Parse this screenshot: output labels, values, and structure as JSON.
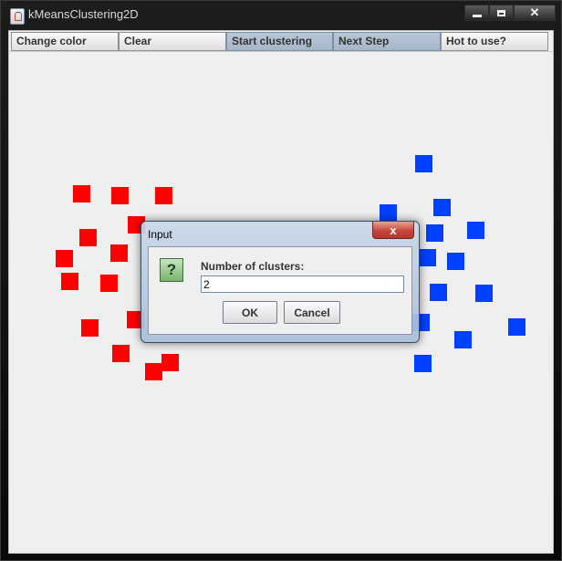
{
  "window": {
    "title": "kMeansClustering2D",
    "app_icon": "java-icon"
  },
  "toolbar": {
    "buttons": [
      {
        "label": "Change color",
        "active": false
      },
      {
        "label": "Clear",
        "active": false
      },
      {
        "label": "Start clustering",
        "active": true
      },
      {
        "label": "Next Step",
        "active": true
      },
      {
        "label": "Hot to use?",
        "active": false
      }
    ]
  },
  "colors": {
    "red_points": "#ff0000",
    "blue_points": "#0040ff",
    "canvas_bg": "#efefef"
  },
  "dialog": {
    "title": "Input",
    "close_glyph": "x",
    "icon": "question-icon",
    "icon_glyph": "?",
    "prompt": "Number of clusters:",
    "input_value": "2",
    "ok_label": "OK",
    "cancel_label": "Cancel"
  }
}
